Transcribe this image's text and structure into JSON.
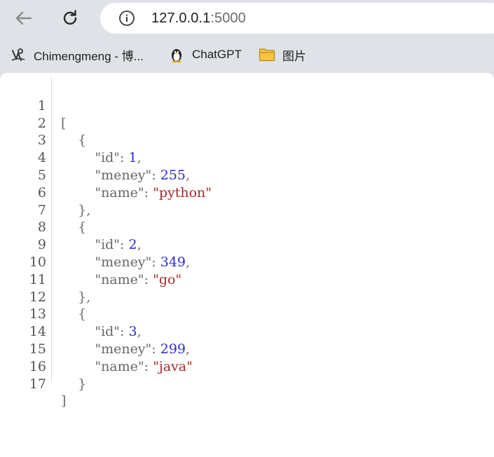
{
  "browser": {
    "url_host": "127.0.0.1",
    "url_port": ":5000"
  },
  "bookmarks": [
    {
      "label": "Chimengmeng - 博...",
      "icon": "blog-logo-icon"
    },
    {
      "label": "ChatGPT",
      "icon": "penguin-icon"
    },
    {
      "label": "图片",
      "icon": "folder-icon"
    }
  ],
  "json_view": {
    "line_numbers": [
      "1",
      "2",
      "3",
      "4",
      "5",
      "6",
      "7",
      "8",
      "9",
      "10",
      "11",
      "12",
      "13",
      "14",
      "15",
      "16",
      "17"
    ],
    "items": [
      {
        "id": "1",
        "meney": "255",
        "name": "\"python\""
      },
      {
        "id": "2",
        "meney": "349",
        "name": "\"go\""
      },
      {
        "id": "3",
        "meney": "299",
        "name": "\"java\""
      }
    ],
    "tokens": {
      "open_array": "[",
      "close_array": "]",
      "open_obj": "{",
      "close_obj_comma": "},",
      "close_obj": "}",
      "key_id": "\"id\"",
      "key_meney": "\"meney\"",
      "key_name": "\"name\"",
      "colon": ": ",
      "comma": ","
    }
  },
  "colors": {
    "number": "#2a2ad8",
    "string": "#a32a2a",
    "punctuation": "#6d6d6d"
  }
}
